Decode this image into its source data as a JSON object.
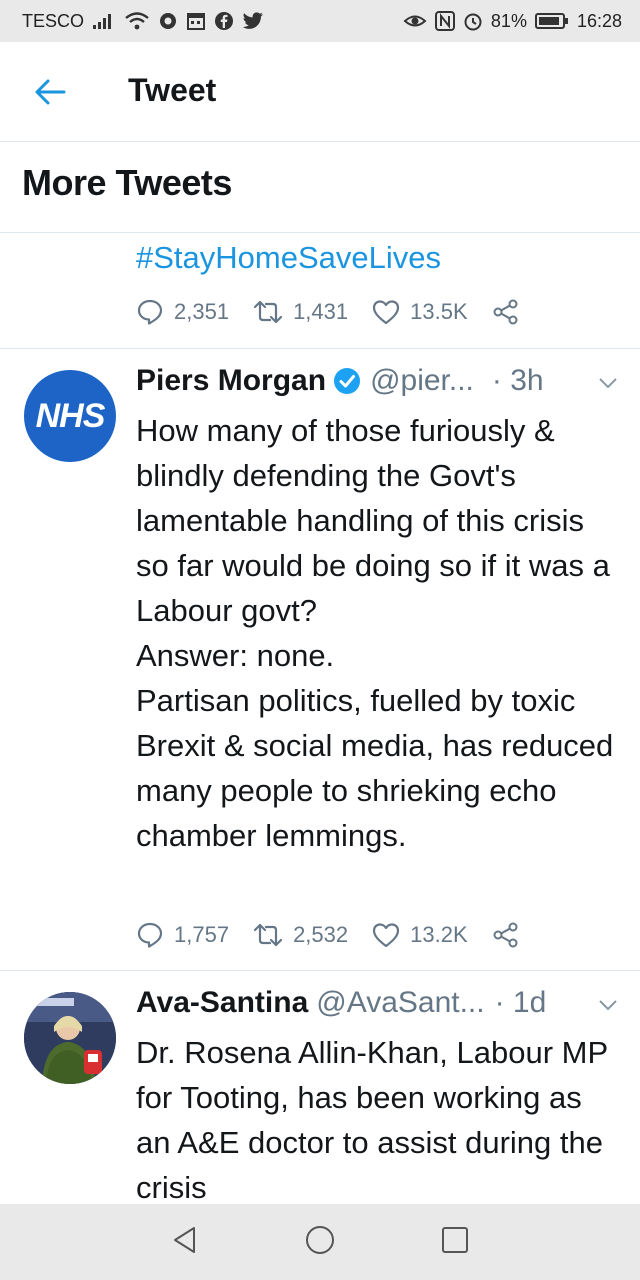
{
  "status_bar": {
    "carrier": "TESCO",
    "battery": "81%",
    "time": "16:28",
    "icons": [
      "signal-icon",
      "wifi-icon",
      "vpn-icon",
      "calendar-icon",
      "facebook-icon",
      "twitter-icon",
      "eye-icon",
      "nfc-icon",
      "alarm-icon",
      "battery-icon"
    ]
  },
  "header": {
    "title": "Tweet",
    "back_icon": "arrow-left-icon"
  },
  "section": {
    "title": "More Tweets"
  },
  "previous_tweet": {
    "hashtag": "#StayHomeSaveLives",
    "replies": "2,351",
    "retweets": "1,431",
    "likes": "13.5K"
  },
  "tweets": [
    {
      "avatar_text": "NHS",
      "author": "Piers Morgan",
      "verified": true,
      "handle": "@pier...",
      "time": "· 3h",
      "text": "How many of those furiously & blindly defending the Govt's lamentable handling of this crisis so far would be doing so if it was a Labour govt?\nAnswer: none.\nPartisan politics, fuelled by toxic Brexit & social media, has reduced many people to shrieking echo chamber lemmings.",
      "replies": "1,757",
      "retweets": "2,532",
      "likes": "13.2K"
    },
    {
      "author": "Ava-Santina",
      "verified": false,
      "handle": "@AvaSant...",
      "time": "· 1d",
      "text": "Dr. Rosena Allin-Khan, Labour MP for Tooting, has been working as an A&E doctor to assist during the crisis"
    }
  ],
  "colors": {
    "accent": "#1b95e0",
    "secondary_text": "#657786",
    "nhs_blue": "#1d64c6",
    "verified": "#1da1f2"
  }
}
